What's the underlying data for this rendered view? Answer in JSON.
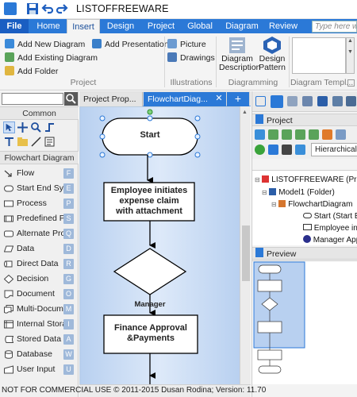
{
  "titlebar": {
    "title": "LISTOFFREEWARE"
  },
  "ribbon_tabs": [
    {
      "label": "File"
    },
    {
      "label": "Home"
    },
    {
      "label": "Insert"
    },
    {
      "label": "Design"
    },
    {
      "label": "Project"
    },
    {
      "label": "Global"
    },
    {
      "label": "Diagram"
    },
    {
      "label": "Review"
    }
  ],
  "search": {
    "placeholder": "Type here wh"
  },
  "ribbon": {
    "project": {
      "add_new_diagram": "Add New Diagram",
      "add_existing_diagram": "Add Existing Diagram",
      "add_folder": "Add Folder",
      "add_presentation": "Add Presentation",
      "group_label": "Project"
    },
    "illustrations": {
      "picture": "Picture",
      "drawings": "Drawings",
      "group_label": "Illustrations"
    },
    "diagramming": {
      "diagram_description": [
        "Diagram",
        "Description"
      ],
      "design_pattern": [
        "Design",
        "Pattern"
      ],
      "group_label": "Diagramming"
    },
    "diagram_templates": {
      "group_label": "Diagram Templ..."
    }
  },
  "shapes_panel": {
    "header_common": "Common",
    "header_flowchart": "Flowchart Diagram",
    "items": [
      {
        "label": "Flow",
        "key": "F"
      },
      {
        "label": "Start End Symb",
        "key": "E"
      },
      {
        "label": "Process",
        "key": "P"
      },
      {
        "label": "Predefined Pro",
        "key": "S"
      },
      {
        "label": "Alternate Proce",
        "key": "Q"
      },
      {
        "label": "Data",
        "key": "D"
      },
      {
        "label": "Direct Data",
        "key": "R"
      },
      {
        "label": "Decision",
        "key": "G"
      },
      {
        "label": "Document",
        "key": "O"
      },
      {
        "label": "Multi-Documen",
        "key": "M"
      },
      {
        "label": "Internal Storage",
        "key": "I"
      },
      {
        "label": "Stored Data",
        "key": "A"
      },
      {
        "label": "Database",
        "key": "W"
      },
      {
        "label": "User Input",
        "key": "U"
      }
    ]
  },
  "document_tabs": [
    {
      "label": "Project Prop..."
    },
    {
      "label": "FlowchartDiag..."
    }
  ],
  "diagram": {
    "start": "Start",
    "process1": [
      "Employee initiates",
      "expense claim",
      "with attachment"
    ],
    "decision": "Manager",
    "process2": [
      "Finance Approval",
      "&Payments"
    ]
  },
  "project_panel": {
    "header": "Project",
    "combo": "Hierarchical V",
    "tree": [
      {
        "label": "LISTOFFREEWARE (Proj"
      },
      {
        "label": "Model1 (Folder)"
      },
      {
        "label": "FlowchartDiagram"
      },
      {
        "label": "Start (Start En"
      },
      {
        "label": "Employee initi"
      },
      {
        "label": "Manager App"
      }
    ]
  },
  "preview_panel": {
    "header": "Preview"
  },
  "statusbar": {
    "text": "NOT FOR COMMERCIAL USE    © 2011-2015 Dusan Rodina; Version: 11.70"
  },
  "colors": {
    "accent": "#2b79d7",
    "canvas_bg": "#cfe0f7",
    "selected_tab": "#2b79d7"
  }
}
